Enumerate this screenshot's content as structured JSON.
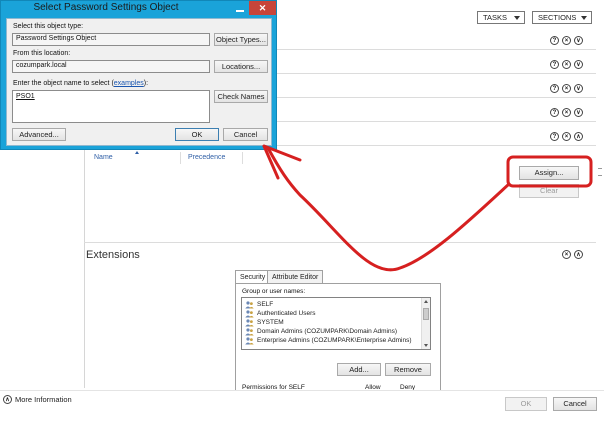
{
  "toolbar": {
    "tasks_label": "TASKS",
    "sections_label": "SECTIONS"
  },
  "sections": {
    "row_controls": [
      "?",
      "×",
      "∨"
    ],
    "collapse_glyph": "∧"
  },
  "assignment": {
    "columns": [
      "Name",
      "Precedence"
    ],
    "assign_button": "Assign...",
    "clear_button": "Clear"
  },
  "extensions": {
    "title": "Extensions",
    "tabs": [
      "Security",
      "Attribute Editor"
    ],
    "group_label": "Group or user names:",
    "users": [
      "SELF",
      "Authenticated Users",
      "SYSTEM",
      "Domain Admins (COZUMPARK\\Domain Admins)",
      "Enterprise Admins (COZUMPARK\\Enterprise Admins)"
    ],
    "add_button": "Add...",
    "remove_button": "Remove",
    "permissions_label": "Permissions for SELF",
    "allow_label": "Allow",
    "deny_label": "Deny"
  },
  "footer": {
    "more_info": "More Information",
    "ok_button": "OK",
    "cancel_button": "Cancel"
  },
  "dialog": {
    "title": "Select Password Settings Object",
    "object_type_label": "Select this object type:",
    "object_type_value": "Password Settings Object",
    "object_types_button": "Object Types...",
    "location_label": "From this location:",
    "location_value": "cozumpark.local",
    "locations_button": "Locations...",
    "enter_label": "Enter the object name to select (",
    "examples_link": "examples",
    "enter_label_end": "):",
    "object_name_value": "PSO1",
    "check_names_button": "Check Names",
    "advanced_button": "Advanced...",
    "ok_button": "OK",
    "cancel_button": "Cancel"
  },
  "colors": {
    "dialog_frame": "#1aa3d9",
    "annotation": "#d62020",
    "link": "#1a56b0"
  }
}
